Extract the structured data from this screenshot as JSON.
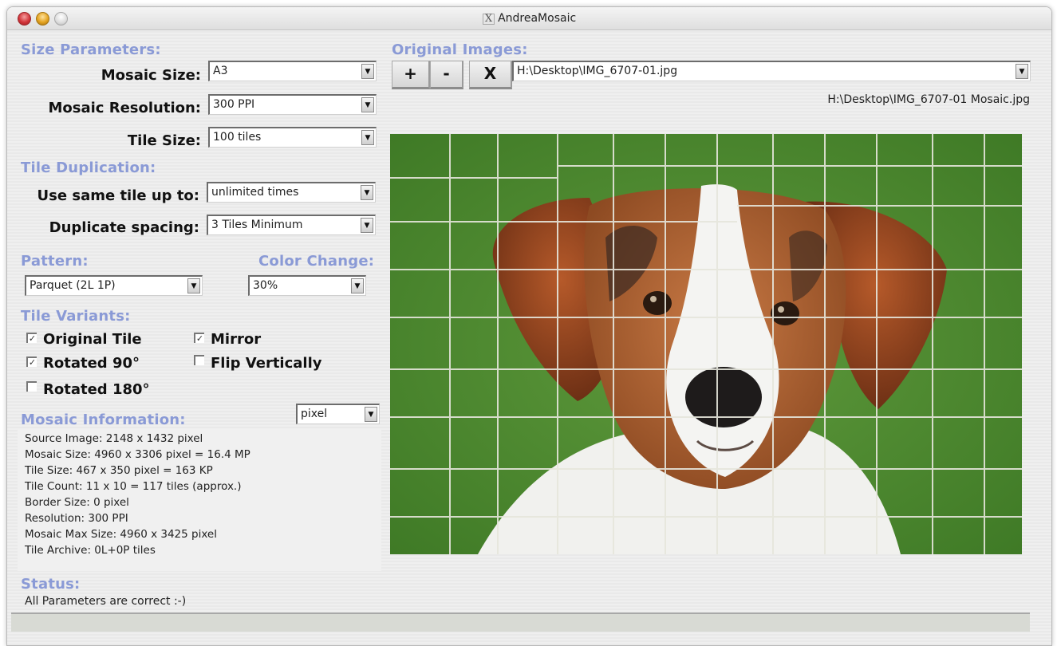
{
  "window": {
    "title": "AndreaMosaic",
    "app_icon": "x11-icon"
  },
  "size_parameters": {
    "heading": "Size Parameters:",
    "mosaic_size": {
      "label": "Mosaic Size:",
      "value": "A3"
    },
    "mosaic_resolution": {
      "label": "Mosaic Resolution:",
      "value": "300 PPI"
    },
    "tile_size": {
      "label": "Tile Size:",
      "value": "100 tiles"
    }
  },
  "tile_duplication": {
    "heading": "Tile Duplication:",
    "use_same_tile": {
      "label": "Use same tile up to:",
      "value": "unlimited times"
    },
    "duplicate_spacing": {
      "label": "Duplicate spacing:",
      "value": "3 Tiles Minimum"
    }
  },
  "pattern": {
    "heading": "Pattern:",
    "value": "Parquet (2L 1P)"
  },
  "color_change": {
    "heading": "Color Change:",
    "value": "30%"
  },
  "tile_variants": {
    "heading": "Tile Variants:",
    "items": [
      {
        "label": "Original Tile",
        "checked": true
      },
      {
        "label": "Mirror",
        "checked": true
      },
      {
        "label": "Rotated 90°",
        "checked": true
      },
      {
        "label": "Flip Vertically",
        "checked": false
      },
      {
        "label": "Rotated 180°",
        "checked": false
      }
    ]
  },
  "mosaic_information": {
    "heading": "Mosaic Information:",
    "unit": "pixel",
    "lines": [
      "Source Image: 2148 x 1432 pixel",
      "Mosaic Size: 4960 x 3306 pixel = 16.4 MP",
      "Tile Size: 467 x 350 pixel = 163 KP",
      "Tile Count: 11 x 10 = 117 tiles (approx.)",
      "Border Size: 0 pixel",
      "Resolution: 300 PPI",
      "Mosaic Max Size: 4960 x 3425 pixel",
      "Tile Archive: 0L+0P tiles"
    ]
  },
  "original_images": {
    "heading": "Original Images:",
    "add_label": "+",
    "remove_label": "-",
    "clear_label": "X",
    "selected_path": "H:\\Desktop\\IMG_6707-01.jpg",
    "output_path": "H:\\Desktop\\IMG_6707-01 Mosaic.jpg"
  },
  "preview": {
    "description": "Mosaic preview of a beagle-mix dog face on green grass, divided into parquet tiles"
  },
  "status": {
    "heading": "Status:",
    "message": "All Parameters are correct :-)",
    "progress_fraction": 0
  }
}
